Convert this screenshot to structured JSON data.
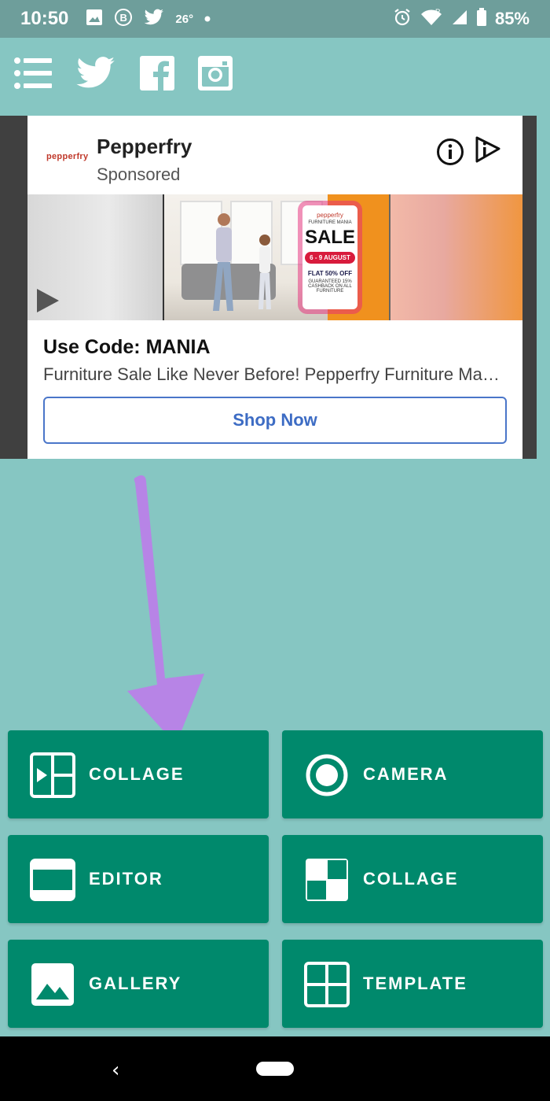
{
  "status_bar": {
    "time": "10:50",
    "temperature": "26°",
    "battery": "85%",
    "icons_left": [
      "image-icon",
      "b-icon",
      "twitter-icon",
      "dot-icon"
    ],
    "icons_right": [
      "alarm-icon",
      "wifi-icon",
      "signal-icon",
      "battery-icon"
    ]
  },
  "toolbar": {
    "icons": [
      "menu-icon",
      "twitter-icon",
      "facebook-icon",
      "instagram-icon"
    ]
  },
  "ad": {
    "logo_text": "pepperfry",
    "brand": "Pepperfry",
    "sponsored": "Sponsored",
    "banner": {
      "brand": "pepperfry",
      "subtitle": "FURNITURE MANIA",
      "headline": "SALE",
      "dates": "6 - 9 AUGUST",
      "offer": "FLAT 50% OFF",
      "cashback": "GUARANTEED 15% CASHBACK ON ALL FURNITURE"
    },
    "headline": "Use Code: MANIA",
    "description": "Furniture Sale Like Never Before!  Pepperfry Furniture Mania Sale",
    "cta": "Shop Now"
  },
  "buttons": [
    {
      "label": "COLLAGE",
      "icon": "collage-video-icon"
    },
    {
      "label": "CAMERA",
      "icon": "camera-icon"
    },
    {
      "label": "EDITOR",
      "icon": "editor-icon"
    },
    {
      "label": "COLLAGE",
      "icon": "collage-grid-icon"
    },
    {
      "label": "GALLERY",
      "icon": "gallery-icon"
    },
    {
      "label": "TEMPLATE",
      "icon": "template-icon"
    }
  ],
  "colors": {
    "background": "#86c6c2",
    "button": "#00896c",
    "arrow": "#b784e6",
    "cta": "#3d6cc4"
  }
}
